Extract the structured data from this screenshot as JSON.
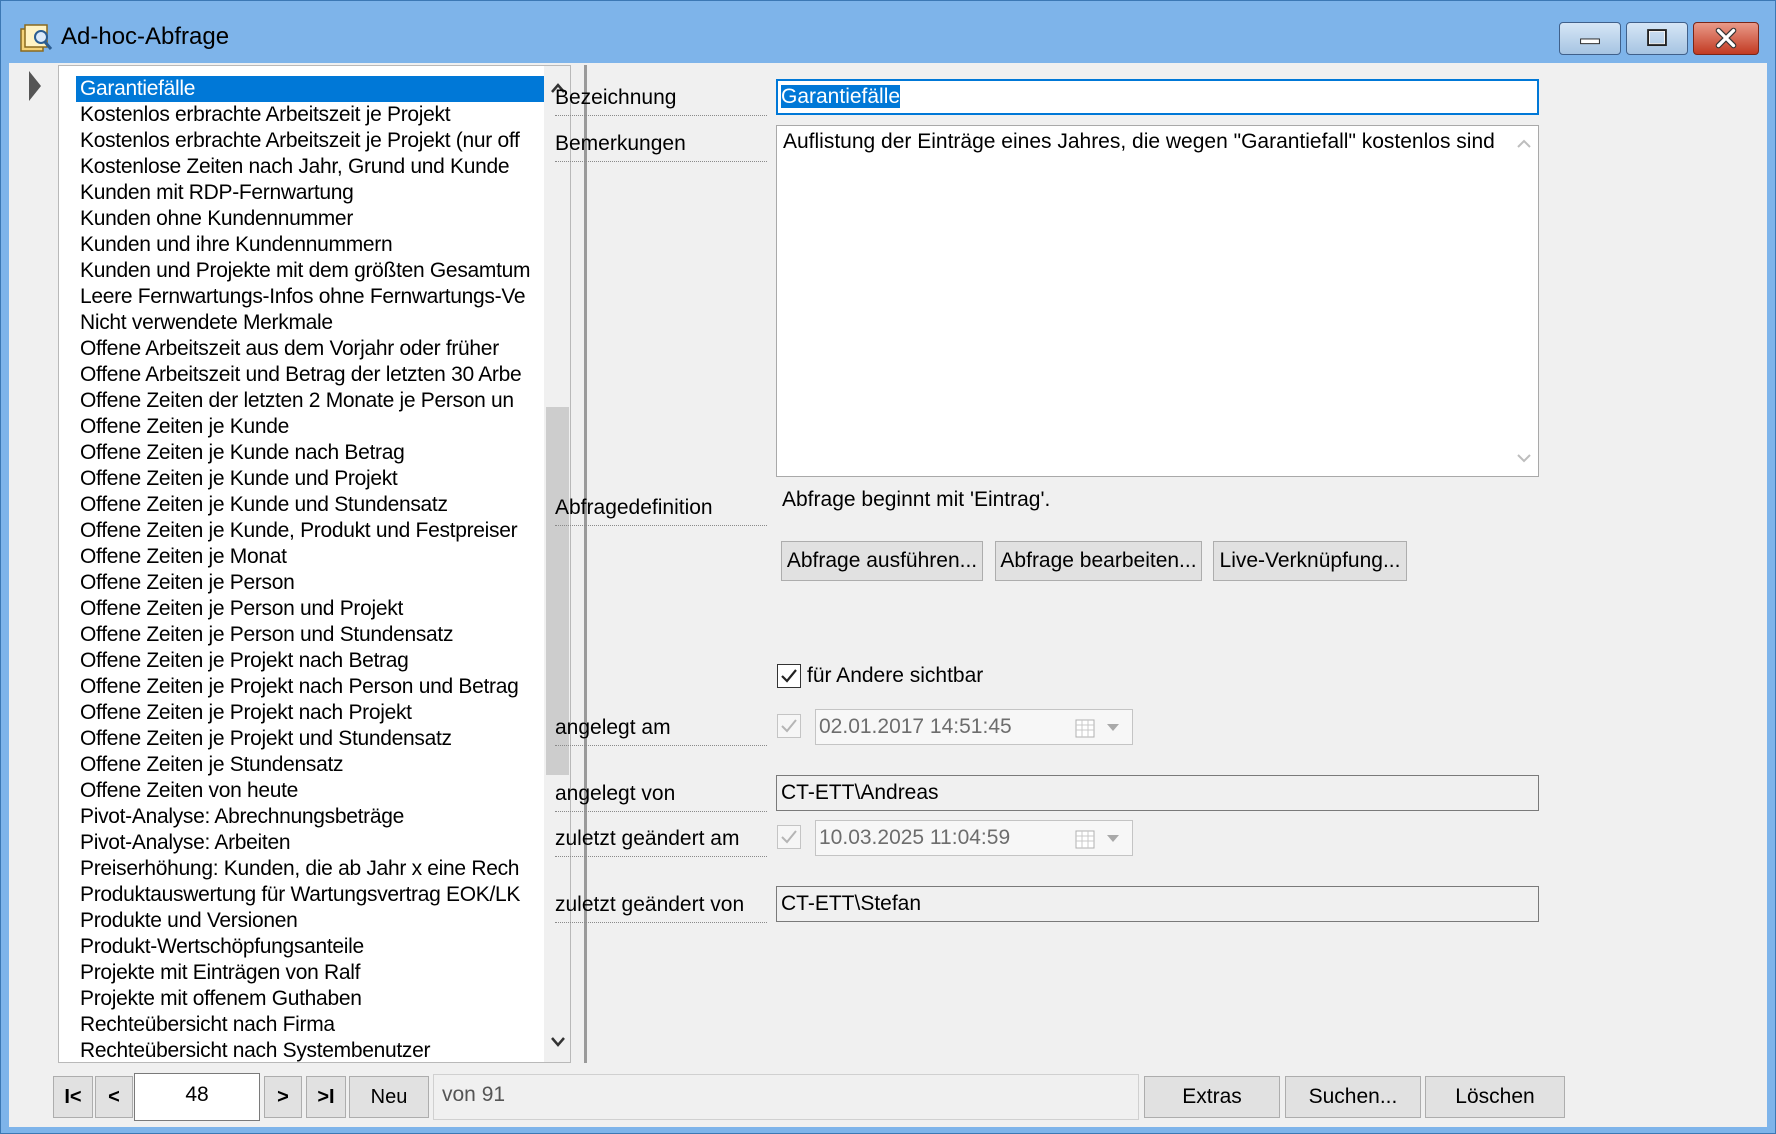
{
  "window": {
    "title": "Ad-hoc-Abfrage"
  },
  "list": {
    "items": [
      "Garantiefälle",
      "Kostenlos erbrachte Arbeitszeit je Projekt",
      "Kostenlos erbrachte Arbeitszeit je Projekt (nur off",
      "Kostenlose Zeiten nach Jahr, Grund und Kunde",
      "Kunden mit RDP-Fernwartung",
      "Kunden ohne Kundennummer",
      "Kunden und ihre Kundennummern",
      "Kunden und Projekte mit dem größten Gesamtum",
      "Leere Fernwartungs-Infos ohne Fernwartungs-Ve",
      "Nicht verwendete Merkmale",
      "Offene Arbeitszeit aus dem Vorjahr oder früher",
      "Offene Arbeitszeit und Betrag der letzten 30 Arbe",
      "Offene Zeiten der letzten 2 Monate je Person un",
      "Offene Zeiten je Kunde",
      "Offene Zeiten je Kunde nach Betrag",
      "Offene Zeiten je Kunde und Projekt",
      "Offene Zeiten je Kunde und Stundensatz",
      "Offene Zeiten je Kunde, Produkt und Festpreiser",
      "Offene Zeiten je Monat",
      "Offene Zeiten je Person",
      "Offene Zeiten je Person und Projekt",
      "Offene Zeiten je Person und Stundensatz",
      "Offene Zeiten je Projekt nach Betrag",
      "Offene Zeiten je Projekt nach Person und Betrag",
      "Offene Zeiten je Projekt nach Projekt",
      "Offene Zeiten je Projekt und Stundensatz",
      "Offene Zeiten je Stundensatz",
      "Offene Zeiten von heute",
      "Pivot-Analyse: Abrechnungsbeträge",
      "Pivot-Analyse: Arbeiten",
      "Preiserhöhung: Kunden, die ab Jahr x eine Rech",
      "Produktauswertung für Wartungsvertrag EOK/LK",
      "Produkte und Versionen",
      "Produkt-Wertschöpfungsanteile",
      "Projekte mit Einträgen von Ralf",
      "Projekte mit offenem Guthaben",
      "Rechteübersicht nach Firma",
      "Rechteübersicht nach Systembenutzer"
    ],
    "selected_index": 0,
    "scroll_fraction": 0.55
  },
  "detail": {
    "bezeichnung": {
      "label": "Bezeichnung",
      "value": "Garantiefälle"
    },
    "bemerkungen": {
      "label": "Bemerkungen",
      "value": "Auflistung der Einträge eines Jahres, die wegen \"Garantiefall\" kostenlos sind"
    },
    "abfragedefinition": {
      "label": "Abfragedefinition",
      "text": "Abfrage beginnt mit 'Eintrag'."
    },
    "buttons": {
      "ausfuehren": "Abfrage ausführen...",
      "bearbeiten": "Abfrage bearbeiten...",
      "live": "Live-Verknüpfung..."
    },
    "sichtbar": {
      "label": "für Andere sichtbar",
      "checked": true
    },
    "angelegt_am": {
      "label": "angelegt am",
      "value": "02.01.2017 14:51:45",
      "checked": true
    },
    "angelegt_von": {
      "label": "angelegt von",
      "value": "CT-ETT\\Andreas"
    },
    "geaendert_am": {
      "label": "zuletzt geändert am",
      "value": "10.03.2025 11:04:59",
      "checked": true
    },
    "geaendert_von": {
      "label": "zuletzt geändert von",
      "value": "CT-ETT\\Stefan"
    }
  },
  "navigator": {
    "first": "I<",
    "prev": "<",
    "record": "48",
    "next": ">",
    "last": ">I",
    "new": "Neu",
    "of_text": "von 91",
    "extras": "Extras",
    "suchen": "Suchen...",
    "loeschen": "Löschen"
  },
  "colors": {
    "selection": "#0078d7",
    "frame": "#7eb4ea",
    "close_button": "#c8402a"
  }
}
